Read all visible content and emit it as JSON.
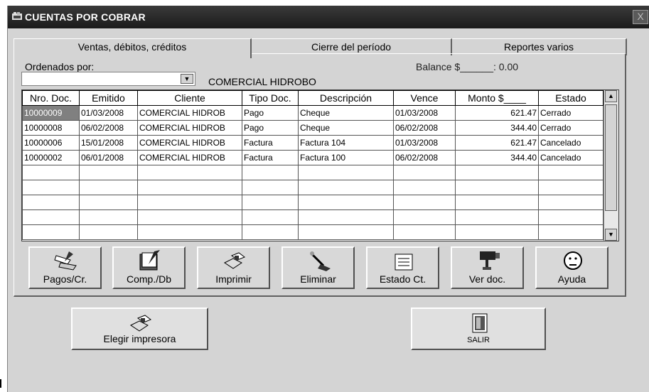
{
  "window": {
    "title": "CUENTAS POR COBRAR",
    "close": "X"
  },
  "tabs": [
    {
      "label": "Ventas, débitos, créditos",
      "active": true
    },
    {
      "label": "Cierre del período",
      "active": false
    },
    {
      "label": "Reportes varios",
      "active": false
    }
  ],
  "filter": {
    "label": "Ordenados por:",
    "value": ""
  },
  "balance": "Balance $______:  0.00",
  "client_name": "COMERCIAL HIDROBO",
  "grid": {
    "columns": [
      "Nro. Doc.",
      "Emitido",
      "Cliente",
      "Tipo Doc.",
      "Descripción",
      "Vence",
      "Monto  $____",
      "Estado"
    ],
    "rows": [
      [
        "10000009",
        "01/03/2008",
        "COMERCIAL HIDROB",
        "Pago",
        "Cheque",
        "01/03/2008",
        "621.47",
        "Cerrado"
      ],
      [
        "10000008",
        "06/02/2008",
        "COMERCIAL HIDROB",
        "Pago",
        "Cheque",
        "06/02/2008",
        "344.40",
        "Cerrado"
      ],
      [
        "10000006",
        "15/01/2008",
        "COMERCIAL HIDROB",
        "Factura",
        "Factura 104",
        "01/03/2008",
        "621.47",
        "Cancelado"
      ],
      [
        "10000002",
        "06/01/2008",
        "COMERCIAL HIDROB",
        "Factura",
        "Factura 100",
        "06/02/2008",
        "344.40",
        "Cancelado"
      ],
      [
        "",
        "",
        "",
        "",
        "",
        "",
        "",
        ""
      ],
      [
        "",
        "",
        "",
        "",
        "",
        "",
        "",
        ""
      ],
      [
        "",
        "",
        "",
        "",
        "",
        "",
        "",
        ""
      ],
      [
        "",
        "",
        "",
        "",
        "",
        "",
        "",
        ""
      ],
      [
        "",
        "",
        "",
        "",
        "",
        "",
        "",
        ""
      ]
    ]
  },
  "toolbar": [
    {
      "label": "Pagos/Cr.",
      "icon": "payment-icon"
    },
    {
      "label": "Comp./Db",
      "icon": "ledger-icon"
    },
    {
      "label": "Imprimir",
      "icon": "printer-icon"
    },
    {
      "label": "Eliminar",
      "icon": "broom-icon"
    },
    {
      "label": "Estado Ct.",
      "icon": "folder-icon"
    },
    {
      "label": "Ver doc.",
      "icon": "camera-icon"
    },
    {
      "label": "Ayuda",
      "icon": "smiley-icon"
    }
  ],
  "bottom": {
    "printer_label": "Elegir impresora",
    "exit_label": "SALIR"
  }
}
